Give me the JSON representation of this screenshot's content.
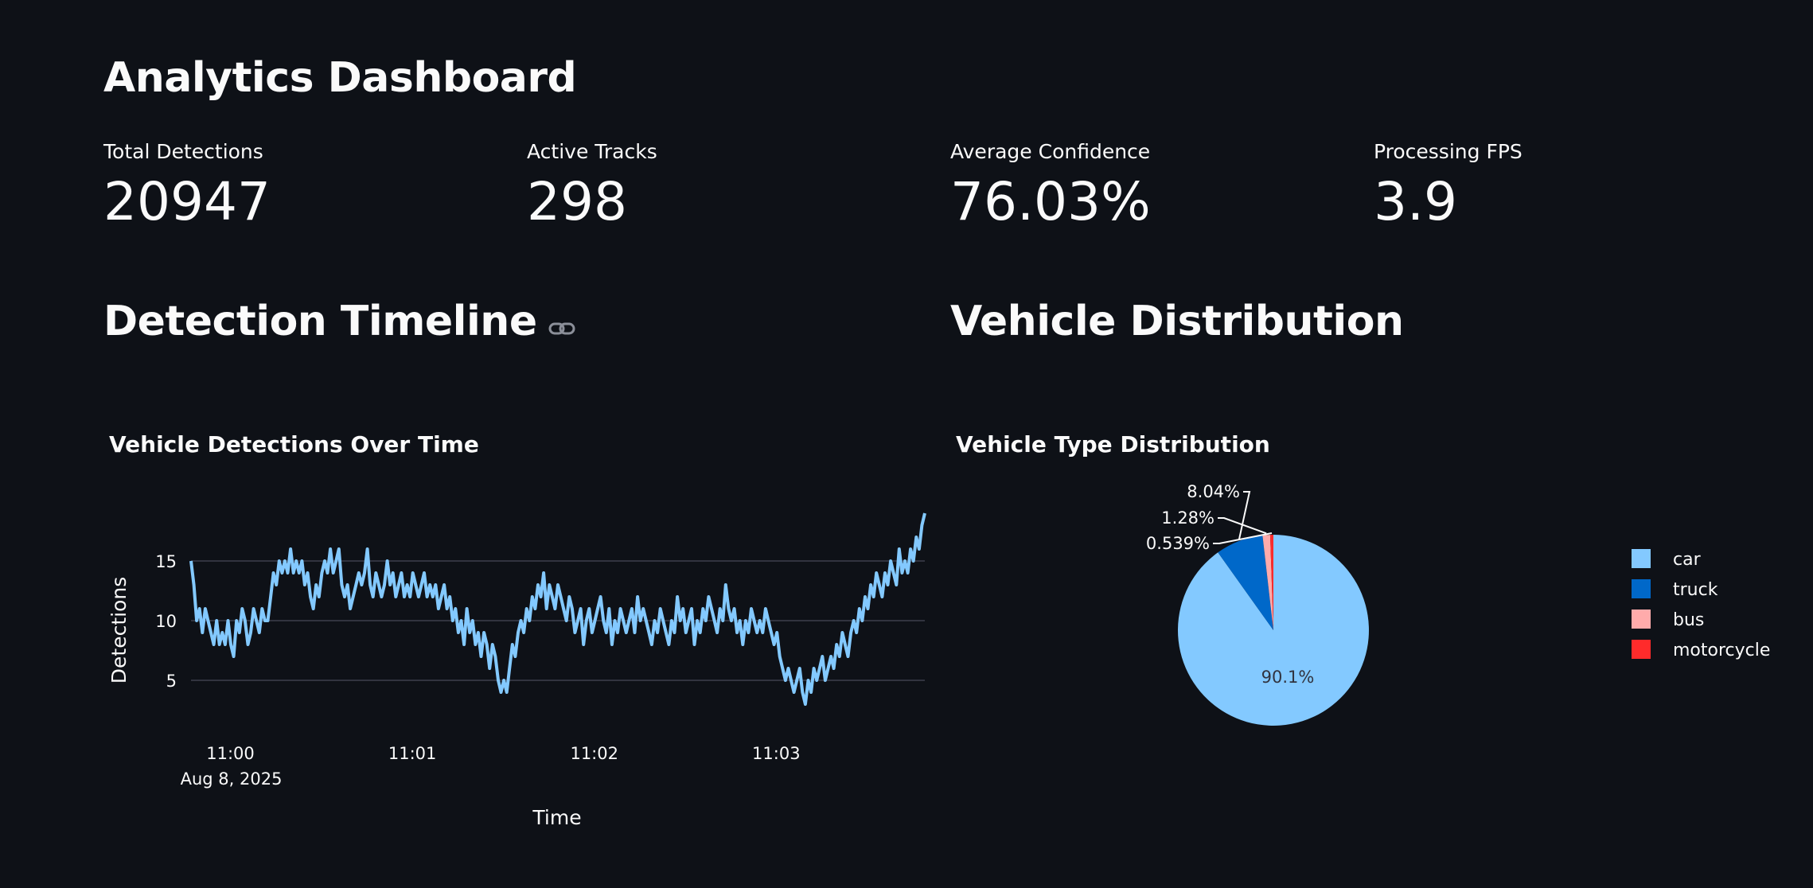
{
  "page": {
    "title": "Analytics Dashboard"
  },
  "metrics": [
    {
      "label": "Total Detections",
      "value": "20947"
    },
    {
      "label": "Active Tracks",
      "value": "298"
    },
    {
      "label": "Average Confidence",
      "value": "76.03%"
    },
    {
      "label": "Processing FPS",
      "value": "3.9"
    }
  ],
  "sections": {
    "timeline": {
      "title": "Detection Timeline",
      "icon": "link-icon"
    },
    "distribution": {
      "title": "Vehicle Distribution"
    }
  },
  "colors": {
    "background": "#0e1117",
    "line": "#83c9ff",
    "car": "#83c9ff",
    "truck": "#0068c9",
    "bus": "#ffabab",
    "motorcycle": "#ff2b2b"
  },
  "chart_data": [
    {
      "type": "line",
      "title": "Vehicle Detections Over Time",
      "xlabel": "Time",
      "ylabel": "Detections",
      "x_ticks": [
        "11:00",
        "11:01",
        "11:02",
        "11:03"
      ],
      "x_tick_sub": "Aug 8, 2025",
      "y_ticks": [
        5,
        10,
        15
      ],
      "ylim": [
        2,
        18
      ],
      "grid": true,
      "x_start": "2025-08-08 10:59:47",
      "x_end": "2025-08-08 11:03:49",
      "series": [
        {
          "values": [
            15,
            13,
            10,
            11,
            9,
            11,
            10,
            9,
            8,
            10,
            8,
            9,
            8,
            10,
            8,
            7,
            10,
            9,
            11,
            10,
            8,
            9,
            11,
            10,
            9,
            11,
            10,
            10,
            12,
            14,
            13,
            15,
            14,
            15,
            14,
            16,
            14,
            15,
            14,
            15,
            13,
            14,
            12,
            11,
            13,
            12,
            14,
            15,
            14,
            16,
            14,
            15,
            16,
            13,
            12,
            13,
            11,
            12,
            13,
            14,
            13,
            14,
            16,
            13,
            12,
            14,
            13,
            12,
            13,
            15,
            13,
            14,
            12,
            13,
            14,
            12,
            13,
            12,
            14,
            13,
            12,
            13,
            14,
            12,
            13,
            12,
            13,
            11,
            12,
            13,
            11,
            12,
            10,
            11,
            9,
            10,
            8,
            11,
            9,
            10,
            8,
            9,
            7,
            9,
            8,
            6,
            8,
            7,
            5,
            4,
            5,
            4,
            6,
            8,
            7,
            9,
            10,
            9,
            11,
            10,
            12,
            11,
            13,
            12,
            14,
            11,
            13,
            12,
            11,
            13,
            12,
            11,
            10,
            12,
            11,
            9,
            10,
            11,
            8,
            10,
            11,
            9,
            10,
            11,
            12,
            10,
            9,
            11,
            8,
            10,
            9,
            11,
            10,
            9,
            10,
            11,
            9,
            12,
            10,
            11,
            10,
            9,
            8,
            10,
            9,
            11,
            10,
            9,
            8,
            10,
            9,
            12,
            10,
            11,
            9,
            10,
            11,
            8,
            10,
            9,
            11,
            10,
            12,
            11,
            10,
            9,
            11,
            10,
            13,
            11,
            10,
            11,
            9,
            10,
            8,
            10,
            9,
            11,
            10,
            9,
            10,
            9,
            11,
            10,
            9,
            8,
            9,
            7,
            6,
            5,
            6,
            5,
            4,
            5,
            6,
            4,
            3,
            5,
            4,
            6,
            5,
            6,
            7,
            5,
            6,
            7,
            6,
            8,
            7,
            9,
            8,
            7,
            9,
            10,
            9,
            11,
            10,
            12,
            11,
            13,
            12,
            14,
            13,
            12,
            14,
            13,
            15,
            14,
            13,
            16,
            14,
            15,
            14,
            16,
            15,
            17,
            16,
            18,
            19
          ]
        }
      ]
    },
    {
      "type": "pie",
      "title": "Vehicle Type Distribution",
      "categories": [
        "car",
        "truck",
        "bus",
        "motorcycle"
      ],
      "values": [
        90.1,
        8.04,
        1.28,
        0.539
      ],
      "labels": [
        "90.1%",
        "8.04%",
        "1.28%",
        "0.539%"
      ],
      "legend": "right"
    }
  ]
}
